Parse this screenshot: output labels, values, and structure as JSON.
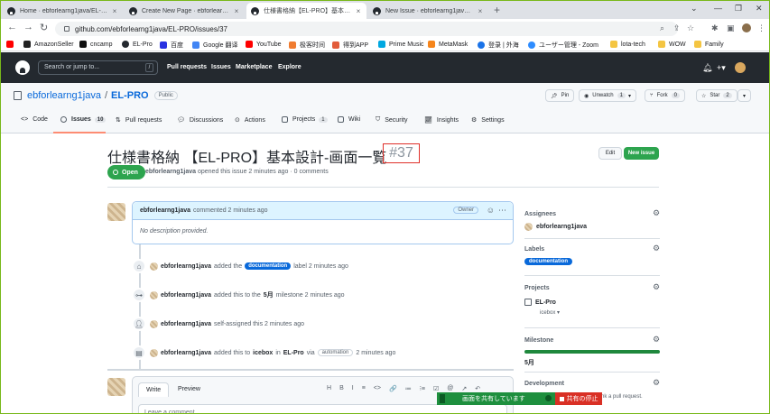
{
  "browser": {
    "tabs": [
      {
        "title": "Home · ebforlearng1java/EL-PRO",
        "close": "×"
      },
      {
        "title": "Create New Page · ebforlearng1java",
        "close": "×"
      },
      {
        "title": "仕様書格納【EL-PRO】基本設計-画",
        "close": "×"
      },
      {
        "title": "New Issue · ebforlearng1java/EL-P",
        "close": "×"
      }
    ],
    "new_tab": "+",
    "url": "github.com/ebforlearng1java/EL-PRO/issues/37",
    "bookmarks": [
      {
        "label": "AmazonSeller",
        "color": "#222222"
      },
      {
        "label": "cncamp",
        "color": "#111111"
      },
      {
        "label": "EL-Pro",
        "color": "#24292f"
      },
      {
        "label": "百度",
        "color": "#2932e1"
      },
      {
        "label": "Google 翻译",
        "color": "#4285f4"
      },
      {
        "label": "YouTube",
        "color": "#ff0000"
      },
      {
        "label": "极客时间",
        "color": "#f07c30"
      },
      {
        "label": "得到APP",
        "color": "#e25c3a"
      },
      {
        "label": "Prime Music",
        "color": "#00a8e1"
      },
      {
        "label": "MetaMask",
        "color": "#f6851b"
      },
      {
        "label": "登录 | 外海",
        "color": "#1a73e8"
      },
      {
        "label": "ユーザー管理 - Zoom",
        "color": "#2d8cff"
      },
      {
        "label": "lota-tech",
        "color": "#f4c542"
      },
      {
        "label": "WOW",
        "color": "#f4c542"
      },
      {
        "label": "Family",
        "color": "#f4c542"
      }
    ]
  },
  "github": {
    "search_placeholder": "Search or jump to...",
    "search_key": "/",
    "nav": [
      "Pull requests",
      "Issues",
      "Marketplace",
      "Explore"
    ]
  },
  "repo": {
    "owner": "ebforlearng1java",
    "separator": "/",
    "name": "EL-PRO",
    "visibility": "Public",
    "pin": "Pin",
    "watch": "Unwatch",
    "watch_count": "1",
    "fork": "Fork",
    "fork_count": "0",
    "star": "Star",
    "star_count": "2",
    "tabs": [
      {
        "label": "Code"
      },
      {
        "label": "Issues",
        "count": "10"
      },
      {
        "label": "Pull requests"
      },
      {
        "label": "Discussions"
      },
      {
        "label": "Actions"
      },
      {
        "label": "Projects",
        "count": "1"
      },
      {
        "label": "Wiki"
      },
      {
        "label": "Security"
      },
      {
        "label": "Insights"
      },
      {
        "label": "Settings"
      }
    ]
  },
  "issue": {
    "title": "仕様書格納 【EL-PRO】基本設計-画面一覧",
    "number": "#37",
    "edit": "Edit",
    "new_issue": "New issue",
    "state": "Open",
    "author": "ebforlearng1java",
    "opened_text": "opened this issue 2 minutes ago · 0 comments"
  },
  "comment": {
    "author": "ebforlearng1java",
    "meta": "commented 2 minutes ago",
    "role": "Owner",
    "body": "No description provided."
  },
  "timeline": [
    {
      "icon": "tag-icon",
      "user": "ebforlearng1java",
      "pre": "added the",
      "label": "documentation",
      "post": "label 2 minutes ago"
    },
    {
      "icon": "milestone-icon",
      "user": "ebforlearng1java",
      "pre": "added this to the",
      "bold": "5月",
      "post": "milestone 2 minutes ago"
    },
    {
      "icon": "person-icon",
      "user": "ebforlearng1java",
      "pre": "self-assigned this 2 minutes ago"
    },
    {
      "icon": "project-icon",
      "user": "ebforlearng1java",
      "pre": "added this to",
      "bold": "icebox",
      "mid": "in",
      "bold2": "EL-Pro",
      "via": "via",
      "tag": "automation",
      "post": "2 minutes ago"
    }
  ],
  "editor": {
    "write": "Write",
    "preview": "Preview",
    "tools": [
      "H",
      "B",
      "I",
      "≡",
      "<>",
      "🔗",
      "≔",
      "⁝≡",
      "☑",
      "@",
      "↗",
      "↶"
    ],
    "placeholder": "Leave a comment"
  },
  "sidebar": {
    "assignees_label": "Assignees",
    "assignee": "ebforlearng1java",
    "labels_label": "Labels",
    "label": "documentation",
    "projects_label": "Projects",
    "project": "EL-Pro",
    "project_status": "icebox ▾",
    "milestone_label": "Milestone",
    "milestone": "5月",
    "milestone_progress": 1.0,
    "development_label": "Development",
    "development_text": "nk a pull request."
  },
  "share": {
    "message": "画面を共有しています",
    "stop": "共有の停止"
  }
}
